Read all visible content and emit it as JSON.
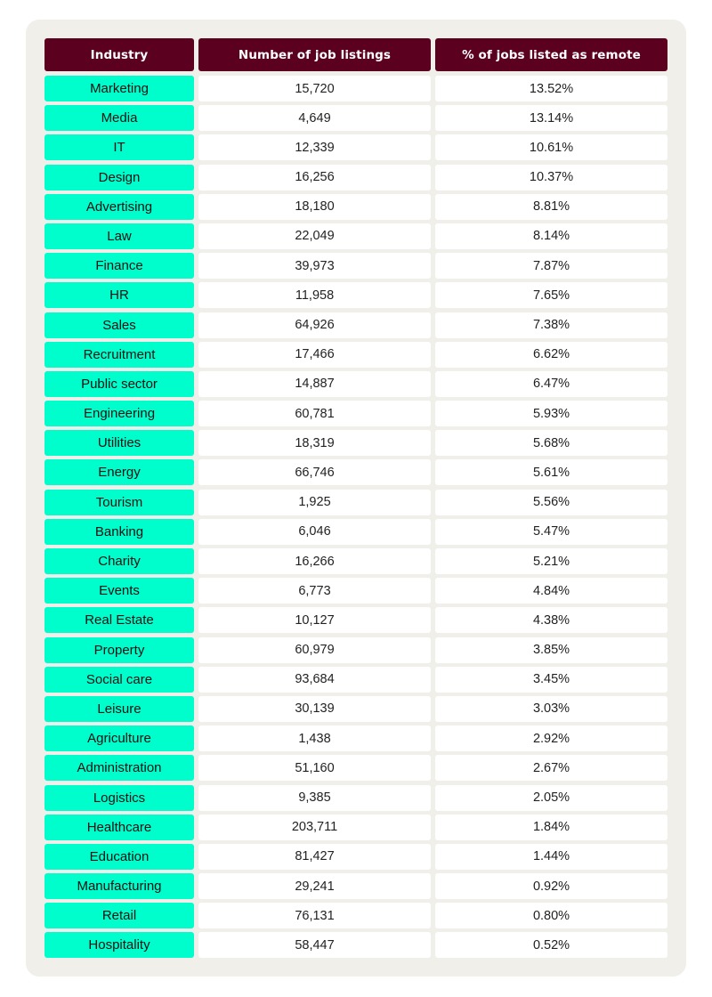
{
  "table": {
    "headers": [
      "Industry",
      "Number of job listings",
      "% of jobs listed as remote"
    ],
    "rows": [
      {
        "industry": "Marketing",
        "listings": "15,720",
        "remote_pct": "13.52%"
      },
      {
        "industry": "Media",
        "listings": "4,649",
        "remote_pct": "13.14%"
      },
      {
        "industry": "IT",
        "listings": "12,339",
        "remote_pct": "10.61%"
      },
      {
        "industry": "Design",
        "listings": "16,256",
        "remote_pct": "10.37%"
      },
      {
        "industry": "Advertising",
        "listings": "18,180",
        "remote_pct": "8.81%"
      },
      {
        "industry": "Law",
        "listings": "22,049",
        "remote_pct": "8.14%"
      },
      {
        "industry": "Finance",
        "listings": "39,973",
        "remote_pct": "7.87%"
      },
      {
        "industry": "HR",
        "listings": "11,958",
        "remote_pct": "7.65%"
      },
      {
        "industry": "Sales",
        "listings": "64,926",
        "remote_pct": "7.38%"
      },
      {
        "industry": "Recruitment",
        "listings": "17,466",
        "remote_pct": "6.62%"
      },
      {
        "industry": "Public sector",
        "listings": "14,887",
        "remote_pct": "6.47%"
      },
      {
        "industry": "Engineering",
        "listings": "60,781",
        "remote_pct": "5.93%"
      },
      {
        "industry": "Utilities",
        "listings": "18,319",
        "remote_pct": "5.68%"
      },
      {
        "industry": "Energy",
        "listings": "66,746",
        "remote_pct": "5.61%"
      },
      {
        "industry": "Tourism",
        "listings": "1,925",
        "remote_pct": "5.56%"
      },
      {
        "industry": "Banking",
        "listings": "6,046",
        "remote_pct": "5.47%"
      },
      {
        "industry": "Charity",
        "listings": "16,266",
        "remote_pct": "5.21%"
      },
      {
        "industry": "Events",
        "listings": "6,773",
        "remote_pct": "4.84%"
      },
      {
        "industry": "Real Estate",
        "listings": "10,127",
        "remote_pct": "4.38%"
      },
      {
        "industry": "Property",
        "listings": "60,979",
        "remote_pct": "3.85%"
      },
      {
        "industry": "Social care",
        "listings": "93,684",
        "remote_pct": "3.45%"
      },
      {
        "industry": "Leisure",
        "listings": "30,139",
        "remote_pct": "3.03%"
      },
      {
        "industry": "Agriculture",
        "listings": "1,438",
        "remote_pct": "2.92%"
      },
      {
        "industry": "Administration",
        "listings": "51,160",
        "remote_pct": "2.67%"
      },
      {
        "industry": "Logistics",
        "listings": "9,385",
        "remote_pct": "2.05%"
      },
      {
        "industry": "Healthcare",
        "listings": "203,711",
        "remote_pct": "1.84%"
      },
      {
        "industry": "Education",
        "listings": "81,427",
        "remote_pct": "1.44%"
      },
      {
        "industry": "Manufacturing",
        "listings": "29,241",
        "remote_pct": "0.92%"
      },
      {
        "industry": "Retail",
        "listings": "76,131",
        "remote_pct": "0.80%"
      },
      {
        "industry": "Hospitality",
        "listings": "58,447",
        "remote_pct": "0.52%"
      }
    ]
  },
  "colors": {
    "header_bg": "#5c0020",
    "header_text": "#ffffff",
    "industry_bg": "#00fdcc",
    "value_bg": "#ffffff",
    "card_bg": "#f0efe9"
  }
}
